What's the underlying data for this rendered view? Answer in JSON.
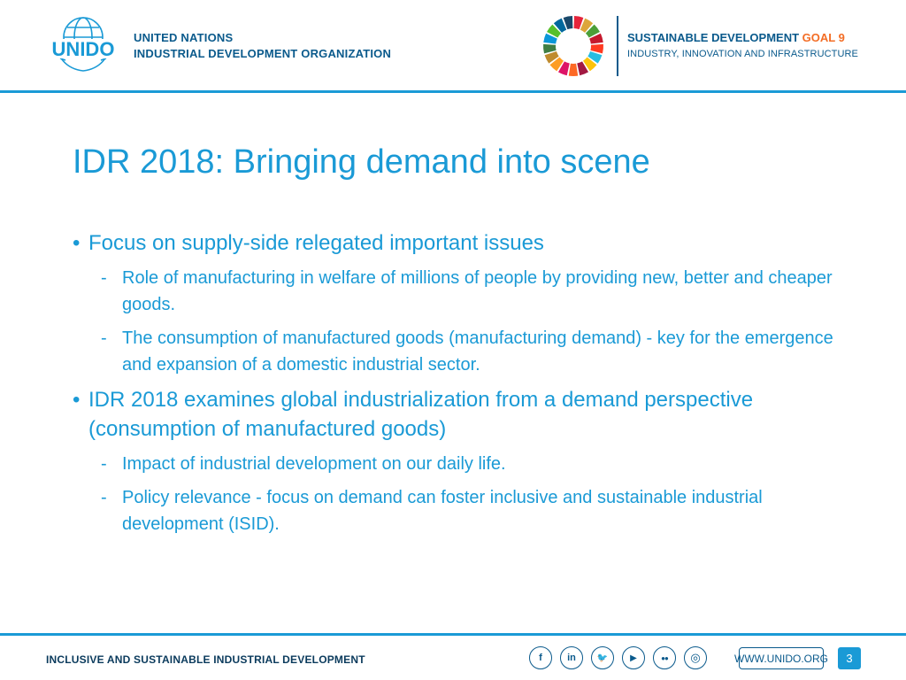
{
  "header": {
    "logo_text": "UNIDO",
    "org_line1": "UNITED NATIONS",
    "org_line2": "INDUSTRIAL DEVELOPMENT ORGANIZATION",
    "sdg_line1_prefix": "SUSTAINABLE DEVELOPMENT ",
    "sdg_goal": "GOAL 9",
    "sdg_line2": "INDUSTRY, INNOVATION AND INFRASTRUCTURE",
    "sdg_colors": [
      "#e5243b",
      "#dda63a",
      "#4c9f38",
      "#c5192d",
      "#ff3a21",
      "#26bde2",
      "#fcc30b",
      "#a21942",
      "#fd6925",
      "#dd1367",
      "#fd9d24",
      "#bf8b2e",
      "#3f7e44",
      "#0a97d9",
      "#56c02b",
      "#00689d",
      "#19486a"
    ]
  },
  "slide": {
    "title": "IDR 2018: Bringing demand into scene",
    "bullets": [
      {
        "mark": "•",
        "text": "Focus on supply-side relegated important issues",
        "subs": [
          {
            "mark": "-",
            "text": "Role of manufacturing in welfare of millions of people by providing new, better and cheaper goods."
          },
          {
            "mark": "-",
            "text": "The consumption of manufactured goods (manufacturing demand) - key for the emergence and expansion of a domestic industrial sector."
          }
        ]
      },
      {
        "mark": "•",
        "text": "IDR 2018  examines global industrialization from a demand perspective (consumption of manufactured goods)",
        "subs": [
          {
            "mark": "-",
            "text": "Impact of industrial development on our daily life."
          },
          {
            "mark": "-",
            "text": "Policy relevance - focus on demand can foster inclusive and sustainable industrial development (ISID)."
          }
        ]
      }
    ]
  },
  "footer": {
    "tagline": "INCLUSIVE AND SUSTAINABLE INDUSTRIAL DEVELOPMENT",
    "social": [
      {
        "name": "facebook-icon",
        "glyph": "f"
      },
      {
        "name": "linkedin-icon",
        "glyph": "in"
      },
      {
        "name": "twitter-icon",
        "glyph": "🐦"
      },
      {
        "name": "youtube-icon",
        "glyph": "▶"
      },
      {
        "name": "flickr-icon",
        "glyph": "●●"
      },
      {
        "name": "instagram-icon",
        "glyph": "◎"
      }
    ],
    "website": "WWW.UNIDO.ORG",
    "page_number": "3"
  },
  "colors": {
    "accent": "#1a9ad6",
    "dark_blue": "#0a5a8c",
    "goal_orange": "#f36d25"
  }
}
